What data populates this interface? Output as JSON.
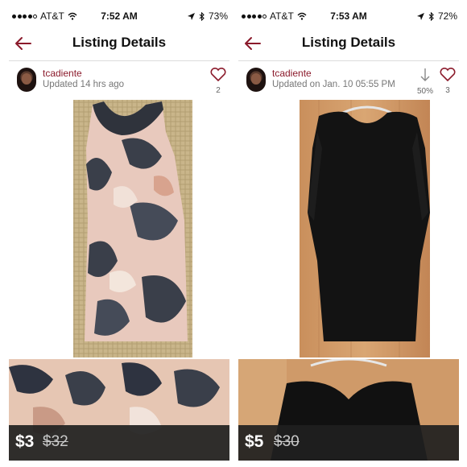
{
  "panels": [
    {
      "status": {
        "carrier": "AT&T",
        "time": "7:52 AM",
        "battery": "73%"
      },
      "nav": {
        "title": "Listing Details"
      },
      "user": {
        "name": "tcadiente",
        "updated": "Updated 14 hrs ago",
        "likes": "2"
      },
      "price": {
        "current": "$3",
        "original": "$32"
      }
    },
    {
      "status": {
        "carrier": "AT&T",
        "time": "7:53 AM",
        "battery": "72%"
      },
      "nav": {
        "title": "Listing Details"
      },
      "user": {
        "name": "tcadiente",
        "updated": "Updated on Jan. 10 05:55 PM",
        "likes": "3",
        "discount": "50%"
      },
      "price": {
        "current": "$5",
        "original": "$30"
      }
    }
  ],
  "colors": {
    "brand": "#8b1a2b",
    "price_bar": "#202020"
  },
  "icons": [
    "back-arrow-icon",
    "heart-icon",
    "price-drop-arrow-icon",
    "wifi-icon",
    "location-icon",
    "bluetooth-icon",
    "battery-icon"
  ]
}
